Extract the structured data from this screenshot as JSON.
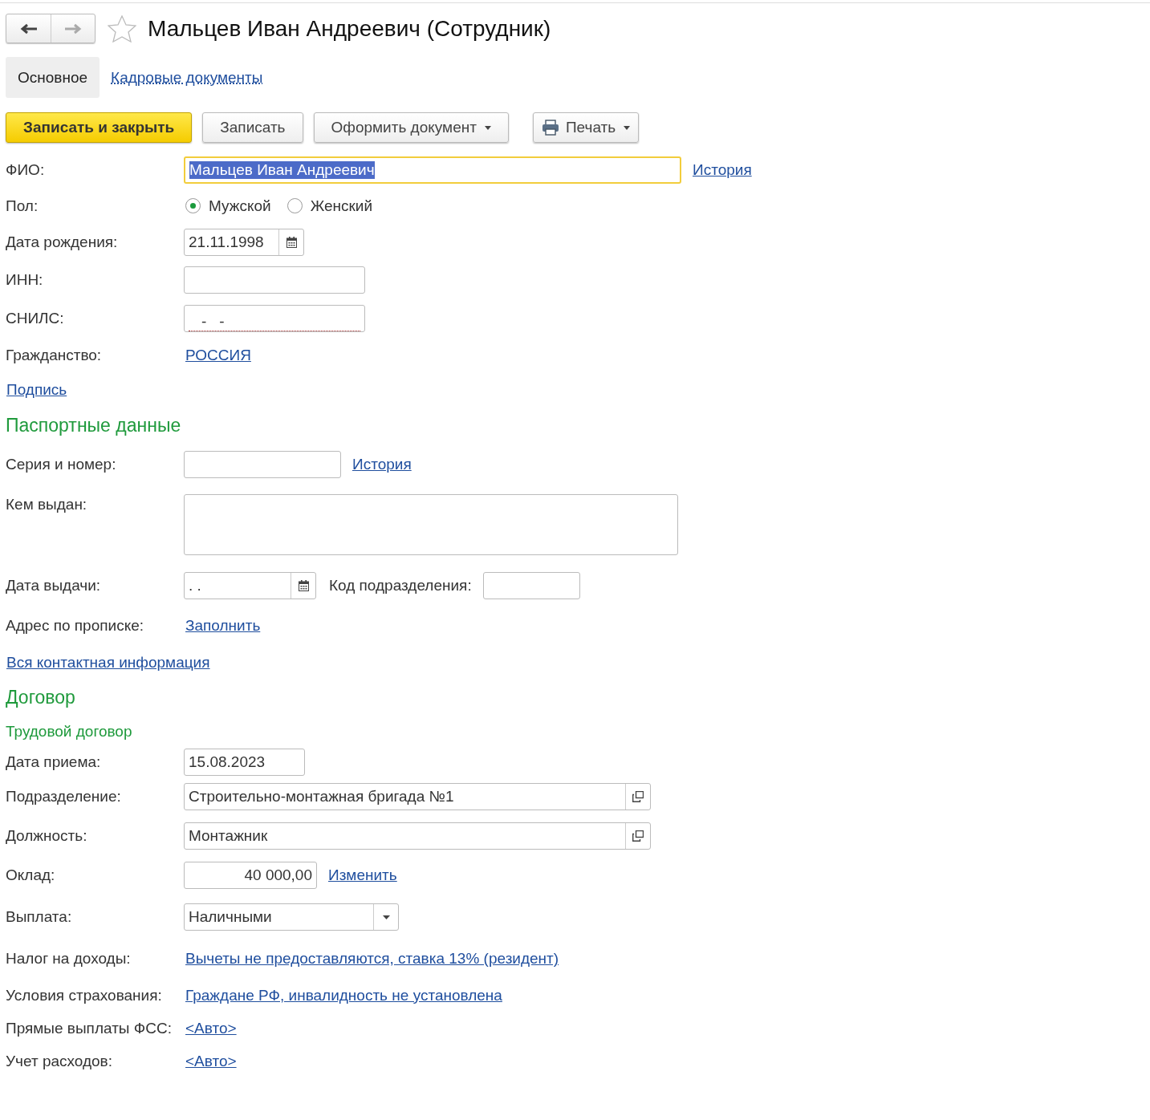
{
  "header": {
    "back_enabled": true,
    "forward_enabled": false,
    "favorite": false,
    "title": "Мальцев Иван Андреевич (Сотрудник)"
  },
  "tabs": [
    {
      "label": "Основное",
      "selected": true
    },
    {
      "label": "Кадровые документы",
      "selected": false
    }
  ],
  "toolbar": [
    {
      "label": "Записать и закрыть",
      "kind": "primary"
    },
    {
      "label": "Записать",
      "kind": "plain"
    },
    {
      "label": "Оформить документ",
      "kind": "menu"
    },
    {
      "label": "Печать",
      "kind": "print"
    }
  ],
  "form": {
    "rows": [
      {
        "kind": "text",
        "label": "ФИО:",
        "value": "Мальцев Иван Андреевич",
        "focused": true,
        "link": "История"
      },
      {
        "kind": "radio",
        "label": "Пол:",
        "options": [
          {
            "label": "Мужской",
            "selected": true
          },
          {
            "label": "Женский",
            "selected": false
          }
        ]
      },
      {
        "kind": "date",
        "label": "Дата рождения:",
        "value": "21.11.1998"
      },
      {
        "kind": "text",
        "label": "ИНН:",
        "focused": false
      },
      {
        "kind": "masked",
        "label": "СНИЛС:",
        "value": "-   -"
      },
      {
        "kind": "link",
        "label": "Гражданство:",
        "link": "РОССИЯ"
      },
      {
        "kind": "standalone_link",
        "link": "Подпись"
      },
      {
        "kind": "heading",
        "text": "Паспортные данные"
      },
      {
        "kind": "text",
        "label": "Серия и номер:",
        "focused": false,
        "link": "История"
      },
      {
        "kind": "textarea",
        "label": "Кем выдан:"
      },
      {
        "kind": "date",
        "label": "Дата выдачи:",
        "value": ". .",
        "extra_label": "Код подразделения:"
      },
      {
        "kind": "link",
        "label": "Адрес по прописке:",
        "link": "Заполнить"
      },
      {
        "kind": "standalone_link",
        "link": "Вся контактная информация"
      },
      {
        "kind": "heading",
        "text": "Договор"
      },
      {
        "kind": "subheading",
        "text": "Трудовой договор"
      },
      {
        "kind": "text",
        "label": "Дата приема:",
        "value": "15.08.2023",
        "focused": false
      },
      {
        "kind": "ref",
        "label": "Подразделение:",
        "value": "Строительно-монтажная бригада №1"
      },
      {
        "kind": "ref",
        "label": "Должность:",
        "value": "Монтажник"
      },
      {
        "kind": "number",
        "label": "Оклад:",
        "value": "40 000,00",
        "link": "Изменить"
      },
      {
        "kind": "select",
        "label": "Выплата:",
        "value": "Наличными"
      },
      {
        "kind": "link",
        "label": "Налог на доходы:",
        "link": "Вычеты не предоставляются, ставка 13% (резидент)"
      },
      {
        "kind": "link",
        "label": "Условия страхования:",
        "link": "Граждане РФ, инвалидность не установлена"
      },
      {
        "kind": "link",
        "label": "Прямые выплаты ФСС:",
        "link": "<Авто>"
      },
      {
        "kind": "link",
        "label": "Учет расходов:",
        "link": "<Авто>"
      }
    ]
  }
}
